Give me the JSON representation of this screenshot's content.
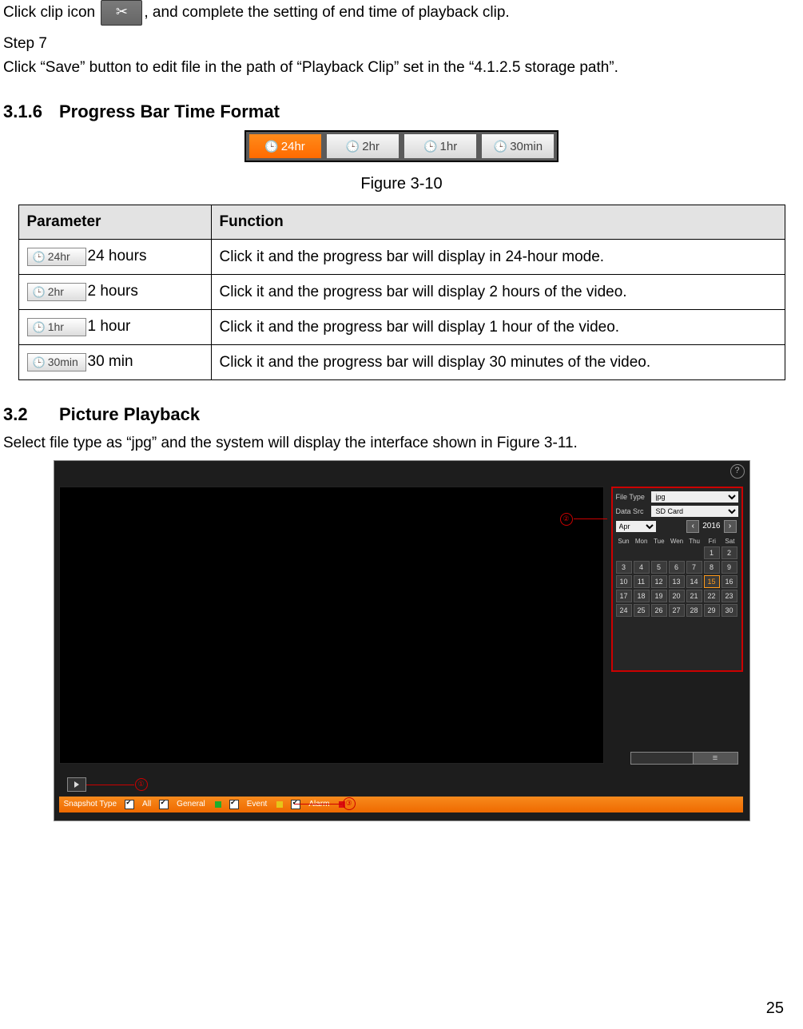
{
  "intro": {
    "line1_pre": "Click clip icon ",
    "line1_post": ", and complete the setting of end time of playback clip.",
    "step7_title": "Step 7",
    "step7_body": "Click “Save” button to edit file in the path of “Playback Clip” set in the “4.1.2.5 storage path”."
  },
  "section_316": {
    "num": "3.1.6",
    "title": "Progress Bar Time Format",
    "fig_label": "Figure 3-10",
    "buttons": {
      "b24": "24hr",
      "b2": "2hr",
      "b1": "1hr",
      "b30": "30min"
    },
    "table": {
      "h1": "Parameter",
      "h2": "Function",
      "rows": [
        {
          "chip": "24hr",
          "label": "24 hours",
          "func": "Click it and the progress bar will display in 24-hour mode."
        },
        {
          "chip": "2hr",
          "label": "2 hours",
          "func": "Click it and the progress bar will display 2 hours of the video."
        },
        {
          "chip": "1hr",
          "label": "1 hour",
          "func": "Click it and the progress bar will display 1 hour of the video."
        },
        {
          "chip": "30min",
          "label": "30 min",
          "func": "Click it and the progress bar will display 30 minutes of the video."
        }
      ]
    }
  },
  "section_32": {
    "num": "3.2",
    "title": "Picture Playback",
    "intro": "Select file type as “jpg” and the system will display the interface shown in Figure 3-11."
  },
  "fig311": {
    "help": "?",
    "file_type_label": "File Type",
    "file_type_value": "jpg",
    "data_src_label": "Data Src",
    "data_src_value": "SD Card",
    "month": "Apr",
    "year": "2016",
    "arrow_left": "‹",
    "arrow_right": "›",
    "dow": [
      "Sun",
      "Mon",
      "Tue",
      "Wen",
      "Thu",
      "Fri",
      "Sat"
    ],
    "days_row1": [
      "",
      "",
      "",
      "",
      "",
      "1",
      "2"
    ],
    "days_row2": [
      "3",
      "4",
      "5",
      "6",
      "7",
      "8",
      "9"
    ],
    "days_row3": [
      "10",
      "11",
      "12",
      "13",
      "14",
      "15",
      "16"
    ],
    "days_row4": [
      "17",
      "18",
      "19",
      "20",
      "21",
      "22",
      "23"
    ],
    "days_row5": [
      "24",
      "25",
      "26",
      "27",
      "28",
      "29",
      "30"
    ],
    "selected_day": "15",
    "snapshot": {
      "title": "Snapshot Type",
      "all": "All",
      "general": "General",
      "event": "Event",
      "alarm": "Alarm"
    },
    "ann": {
      "a1": "①",
      "a2": "②",
      "a3": "③"
    }
  },
  "page_number": "25"
}
